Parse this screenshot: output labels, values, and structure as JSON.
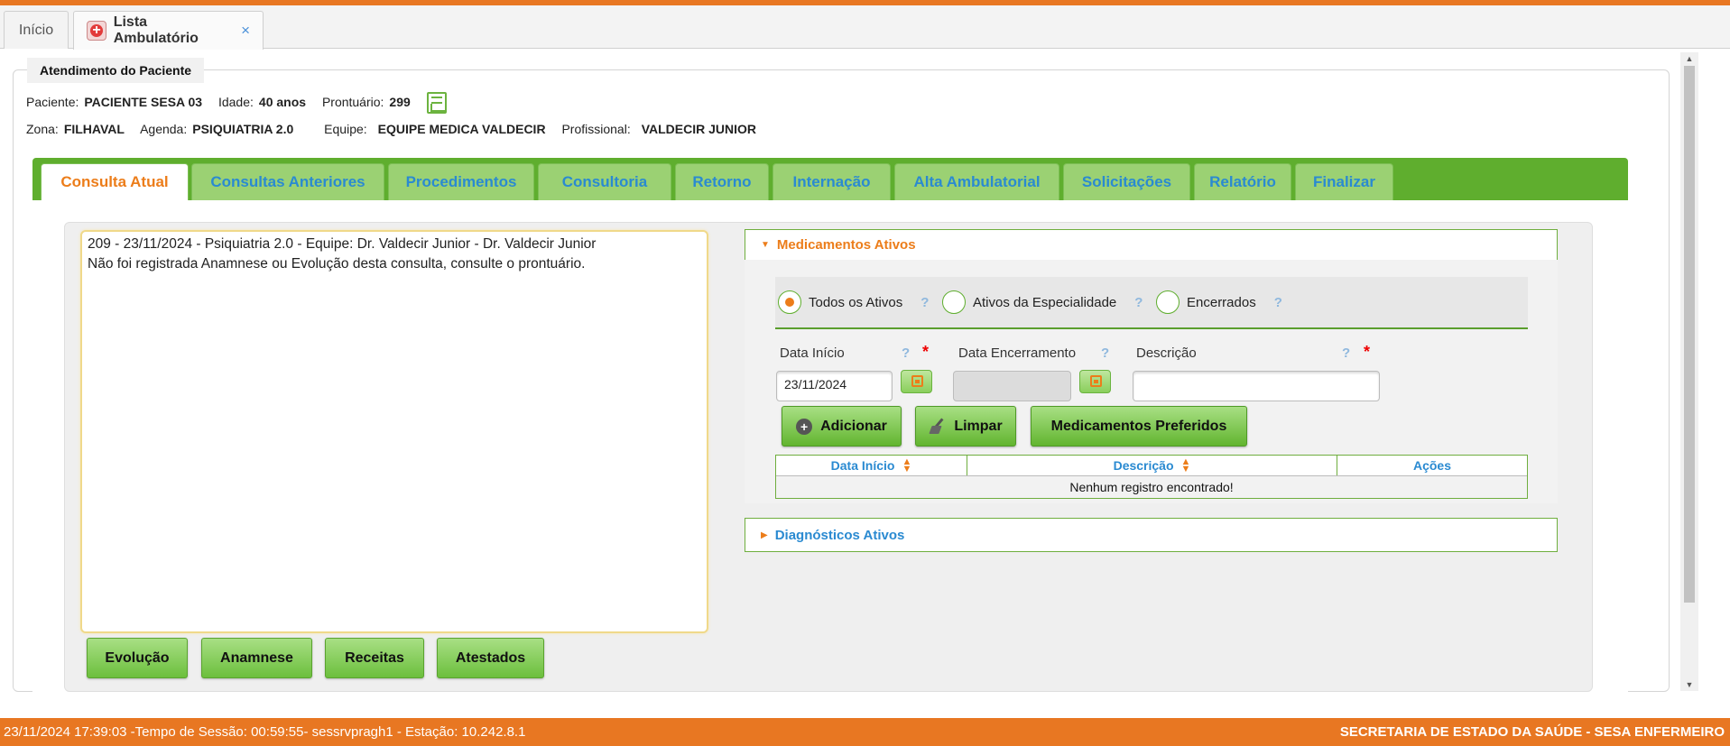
{
  "tabs": {
    "home_label": "Início",
    "active_label": "Lista Ambulatório",
    "close_symbol": "×"
  },
  "panel": {
    "legend": "Atendimento do Paciente"
  },
  "patient": {
    "paciente_label": "Paciente:",
    "paciente_value": "PACIENTE SESA 03",
    "idade_label": "Idade:",
    "idade_value": "40 anos",
    "prontuario_label": "Prontuário:",
    "prontuario_value": "299",
    "zona_label": "Zona:",
    "zona_value": "FILHAVAL",
    "agenda_label": "Agenda:",
    "agenda_value": "PSIQUIATRIA 2.0",
    "equipe_label": "Equipe:",
    "equipe_value": "EQUIPE MEDICA VALDECIR",
    "profissional_label": "Profissional:",
    "profissional_value": "VALDECIR JUNIOR"
  },
  "nav_tabs": [
    {
      "label": "Consulta Atual"
    },
    {
      "label": "Consultas Anteriores"
    },
    {
      "label": "Procedimentos"
    },
    {
      "label": "Consultoria"
    },
    {
      "label": "Retorno"
    },
    {
      "label": "Internação"
    },
    {
      "label": "Alta Ambulatorial"
    },
    {
      "label": "Solicitações"
    },
    {
      "label": "Relatório"
    },
    {
      "label": "Finalizar"
    }
  ],
  "notes": {
    "line1": "209 - 23/11/2024 - Psiquiatria 2.0 - Equipe: Dr. Valdecir Junior - Dr. Valdecir Junior",
    "line2": "Não foi registrada Anamnese ou Evolução desta consulta, consulte o prontuário."
  },
  "bottom_buttons": {
    "evolucao": "Evolução",
    "anamnese": "Anamnese",
    "receitas": "Receitas",
    "atestados": "Atestados"
  },
  "medicamentos": {
    "title": "Medicamentos Ativos",
    "radio_todos": "Todos os Ativos",
    "radio_especialidade": "Ativos da Especialidade",
    "radio_encerrados": "Encerrados",
    "help_symbol": "?",
    "required_symbol": "*",
    "data_inicio_label": "Data Início",
    "data_encerramento_label": "Data Encerramento",
    "descricao_label": "Descrição",
    "data_inicio_value": "23/11/2024",
    "data_encerramento_value": "",
    "descricao_value": "",
    "btn_adicionar": "Adicionar",
    "btn_limpar": "Limpar",
    "btn_preferidos": "Medicamentos Preferidos",
    "grid_col_data": "Data Início",
    "grid_col_descricao": "Descrição",
    "grid_col_acoes": "Ações",
    "grid_empty": "Nenhum registro encontrado!"
  },
  "diagnosticos": {
    "title": "Diagnósticos Ativos"
  },
  "footer": {
    "left": "23/11/2024 17:39:03 -Tempo de Sessão: 00:59:55- sessrvpragh1 - Estação: 10.242.8.1",
    "right": "SECRETARIA DE ESTADO DA SAÚDE - SESA ENFERMEIRO"
  },
  "colors": {
    "accent_orange": "#e87722",
    "nav_green": "#5fae2e",
    "tab_green": "#9bd173",
    "link_blue": "#2a8ad1"
  }
}
